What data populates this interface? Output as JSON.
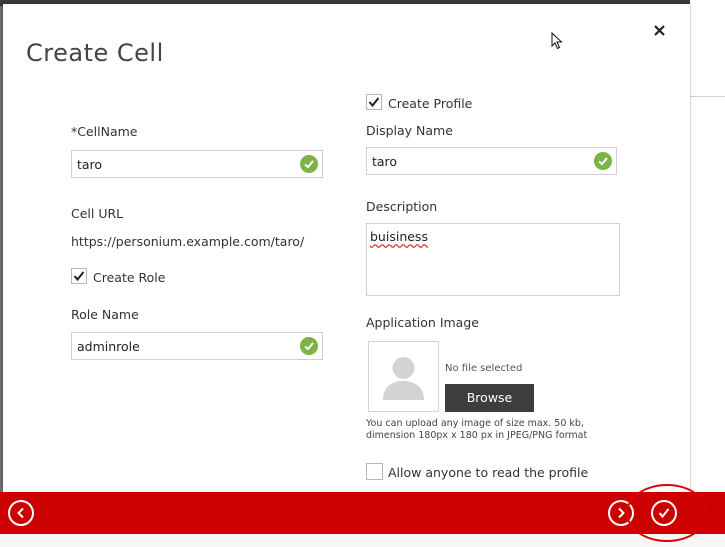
{
  "dialog": {
    "title": "Create Cell"
  },
  "left": {
    "cellname_label": "*CellName",
    "cellname_value": "taro",
    "cell_url_label": "Cell URL",
    "cell_url_value": "https://personium.example.com/taro/",
    "create_role_label": "Create Role",
    "create_role_checked": true,
    "role_name_label": "Role Name",
    "role_name_value": "adminrole"
  },
  "right": {
    "create_profile_label": "Create Profile",
    "create_profile_checked": true,
    "display_name_label": "Display Name",
    "display_name_value": "taro",
    "description_label": "Description",
    "description_value": "buisiness",
    "application_image_label": "Application Image",
    "no_file_text": "No file selected",
    "browse_label": "Browse",
    "upload_note": "You can upload any image of size max. 50 kb, dimension 180px x 180 px in JPEG/PNG format",
    "allow_read_label": "Allow anyone to read the profile",
    "allow_read_checked": false
  },
  "icons": {
    "close": "close-icon",
    "back": "back-arrow-icon",
    "next": "next-arrow-icon",
    "confirm": "confirm-check-icon",
    "valid": "valid-check-icon"
  },
  "colors": {
    "footer_red": "#cc0000",
    "valid_green": "#7cb342",
    "annotation_red": "#dd0000"
  }
}
